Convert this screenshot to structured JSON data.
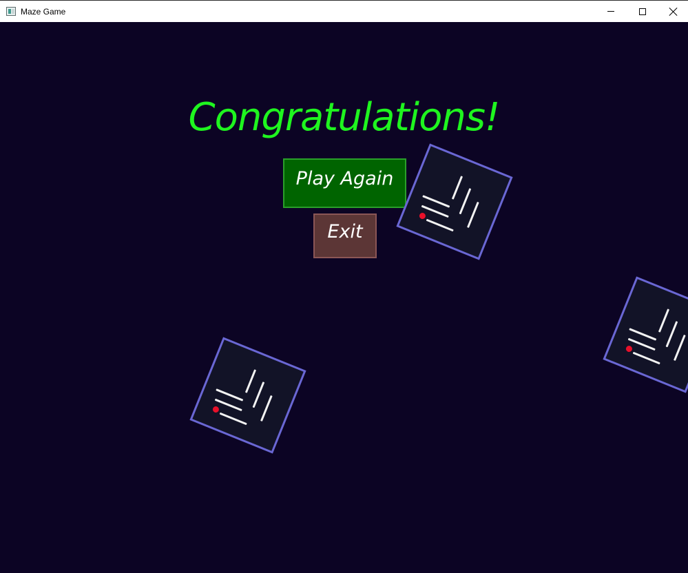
{
  "window": {
    "title": "Maze Game",
    "controls": [
      "minimize",
      "maximize",
      "close"
    ]
  },
  "game": {
    "heading": "Congratulations!",
    "buttons": {
      "play_again": "Play Again",
      "exit": "Exit"
    },
    "colors": {
      "background": "#0c0424",
      "heading": "#1ff51f",
      "play_again_bg": "#006400",
      "exit_bg": "#5c3636",
      "tile_border": "#6a67d4",
      "ball": "#e8102a"
    },
    "maze_tiles": 3
  }
}
